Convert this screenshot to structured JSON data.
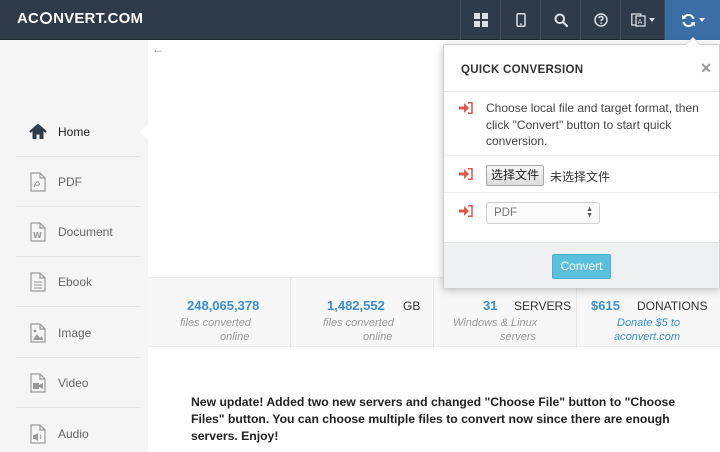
{
  "header": {
    "logo_text_a": "AC",
    "logo_text_b": "NVERT.COM",
    "icons": [
      "grid-icon",
      "mobile-icon",
      "search-icon",
      "help-icon",
      "language-icon",
      "refresh-icon"
    ]
  },
  "sidebar": {
    "items": [
      {
        "label": "Home",
        "icon": "home-icon",
        "active": true
      },
      {
        "label": "PDF",
        "icon": "pdf-file-icon"
      },
      {
        "label": "Document",
        "icon": "word-file-icon"
      },
      {
        "label": "Ebook",
        "icon": "ebook-file-icon"
      },
      {
        "label": "Image",
        "icon": "image-file-icon"
      },
      {
        "label": "Video",
        "icon": "video-file-icon"
      },
      {
        "label": "Audio",
        "icon": "audio-file-icon"
      }
    ]
  },
  "stats": [
    {
      "num": "248,065,378",
      "unit": "",
      "sub1": "files converted",
      "sub2": "online"
    },
    {
      "num": "1,482,552",
      "unit": "GB",
      "sub1": "files converted",
      "sub2": "online"
    },
    {
      "num": "31",
      "unit": "SERVERS",
      "sub1": "Windows & Linux",
      "sub2": "servers"
    },
    {
      "num": "$615",
      "unit": "DONATIONS",
      "sub1": "Donate $5 to",
      "sub2": "aconvert.com"
    }
  ],
  "news": "New update! Added two new servers and changed \"Choose File\" button to \"Choose Files\" button. You can choose multiple files to convert now since there are enough servers. Enjoy!",
  "quick": {
    "title": "QUICK CONVERSION",
    "instructions": "Choose local file and target format, then click \"Convert\" button to start quick conversion.",
    "file_button": "选择文件",
    "no_file": "未选择文件",
    "format": "PDF",
    "convert_label": "Convert",
    "accent_color": "#5bc0de",
    "arrow_color": "#e2574c"
  }
}
